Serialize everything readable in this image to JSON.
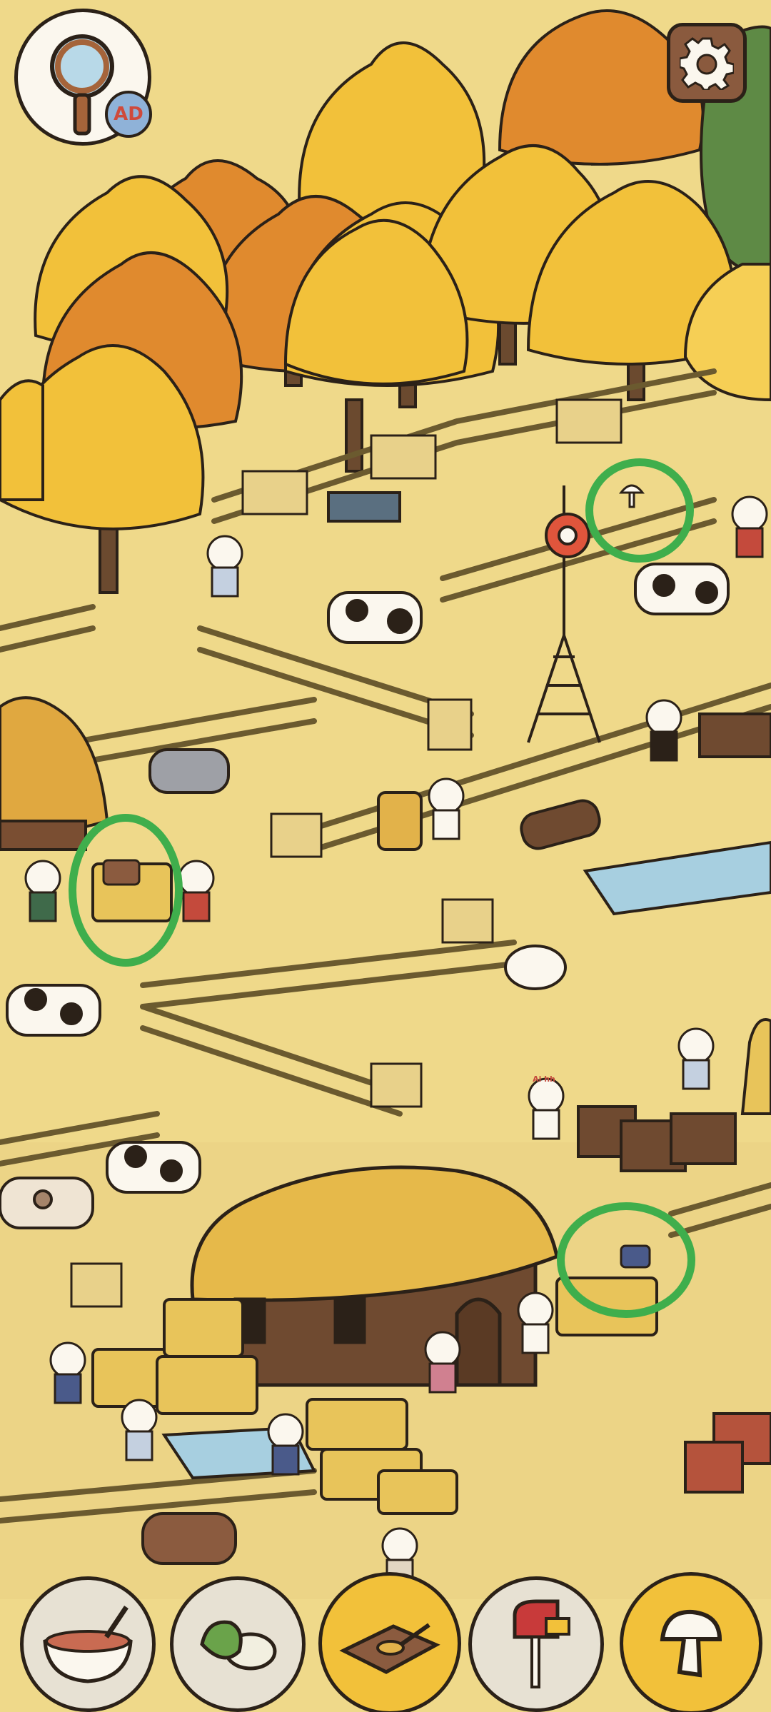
{
  "hud": {
    "hint_button": {
      "icon": "magnifier-icon",
      "badge_label": "AD"
    },
    "settings_button": {
      "icon": "gear-icon"
    }
  },
  "scene": {
    "theme": "autumn farm",
    "found_markers_count": 3,
    "marker_color": "#3fae4c",
    "cap_text": "Ai hh"
  },
  "item_tray": {
    "items": [
      {
        "name": "soup-bowl",
        "icon": "soup-bowl-icon",
        "state": "remaining"
      },
      {
        "name": "bok-choy",
        "icon": "bok-choy-icon",
        "state": "remaining"
      },
      {
        "name": "cutting-board",
        "icon": "cutting-board-icon",
        "state": "selected"
      },
      {
        "name": "mailbox",
        "icon": "mailbox-icon",
        "state": "remaining"
      },
      {
        "name": "mushroom",
        "icon": "mushroom-icon",
        "state": "selected"
      }
    ]
  },
  "colors": {
    "ground": "#efd98a",
    "tree_yellow": "#f2c13a",
    "tree_orange": "#e08a2e",
    "tray_active": "#f2c13a",
    "tray_inactive": "#e7e1d3",
    "outline": "#2b2118"
  }
}
